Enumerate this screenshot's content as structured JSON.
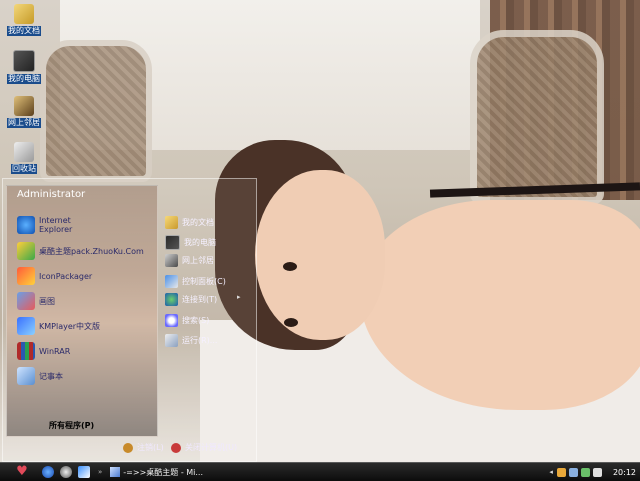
{
  "desktop": {
    "icons": [
      {
        "label": "我的文档",
        "icon": "my-documents-icon"
      },
      {
        "label": "我的电脑",
        "icon": "my-computer-icon"
      },
      {
        "label": "网上邻居",
        "icon": "network-places-icon"
      },
      {
        "label": "回收站",
        "icon": "recycle-bin-icon"
      }
    ]
  },
  "start_menu": {
    "user": "Administrator",
    "left_items": [
      {
        "label": "Internet\nExplorer",
        "icon": "internet-explorer-icon"
      },
      {
        "label": "桌酷主题pack.ZhuoKu.Com",
        "icon": "theme-pack-icon"
      },
      {
        "label": "IconPackager",
        "icon": "iconpackager-icon"
      },
      {
        "label": "画图",
        "icon": "paint-icon"
      },
      {
        "label": "KMPlayer中文版",
        "icon": "kmplayer-icon"
      },
      {
        "label": "WinRAR",
        "icon": "winrar-icon"
      },
      {
        "label": "记事本",
        "icon": "notepad-icon"
      }
    ],
    "right_items": [
      {
        "label": "我的文档",
        "icon": "my-documents-icon"
      },
      {
        "label": "我的电脑",
        "icon": "my-computer-icon"
      },
      {
        "label": "网上邻居",
        "icon": "network-places-icon"
      },
      {
        "label": "控制面板(C)",
        "icon": "control-panel-icon"
      },
      {
        "label": "连接到(T)",
        "icon": "connect-to-icon"
      },
      {
        "label": "搜索(S)",
        "icon": "search-icon"
      },
      {
        "label": "运行(R)...",
        "icon": "run-icon"
      }
    ],
    "all_programs": "所有程序(P)",
    "logoff": "注销(L)",
    "shutdown": "关闭计算机(U)",
    "submenu_arrow": "▸"
  },
  "taskbar": {
    "start_icon": "♥",
    "quick_launch": [
      "internet-explorer-icon",
      "show-desktop-icon",
      "media-player-icon"
    ],
    "more": "»",
    "task": "-=>>桌酷主题 - Mi...",
    "tray_expand": "◂",
    "clock": "20:12"
  }
}
